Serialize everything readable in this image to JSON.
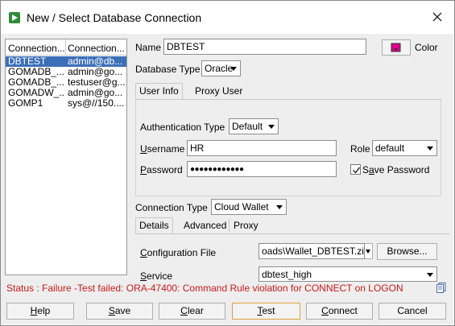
{
  "window": {
    "title": "New / Select Database Connection"
  },
  "connections": {
    "headers": [
      "Connection...",
      "Connection..."
    ],
    "rows": [
      {
        "name": "DBTEST",
        "details": "admin@db..."
      },
      {
        "name": "GOMADB_...",
        "details": "admin@go..."
      },
      {
        "name": "GOMADB_...",
        "details": "testuser@g..."
      },
      {
        "name": "GOMADW_...",
        "details": "admin@go..."
      },
      {
        "name": "GOMP1",
        "details": "sys@//150...."
      }
    ]
  },
  "form": {
    "name_label": "Name",
    "name_value": "DBTEST",
    "color_label": "Color",
    "color_swatch": "#e0008c",
    "db_type_label": "Database Type",
    "db_type_value": "Oracle",
    "tabs": [
      "User Info",
      "Proxy User"
    ],
    "auth_type_label": "Authentication Type",
    "auth_type_value": "Default",
    "username_label": "Username",
    "username_value": "HR",
    "role_label": "Role",
    "role_value": "default",
    "password_label": "Password",
    "password_value": "●●●●●●●●●●●●",
    "save_password_label": "Save Password",
    "save_password_checked": true,
    "conn_type_label": "Connection Type",
    "conn_type_value": "Cloud Wallet",
    "conn_tabs": [
      "Details",
      "Advanced",
      "Proxy"
    ],
    "config_file_label": "Configuration File",
    "config_file_value": "oads\\Wallet_DBTEST.zip",
    "browse_label": "Browse...",
    "service_label": "Service",
    "service_value": "dbtest_high"
  },
  "status": {
    "text": "Status : Failure -Test failed: ORA-47400: Command Rule violation for CONNECT on LOGON",
    "color": "#cc1a1a"
  },
  "buttons": {
    "help": "Help",
    "save": "Save",
    "clear": "Clear",
    "test": "Test",
    "connect": "Connect",
    "cancel": "Cancel"
  }
}
